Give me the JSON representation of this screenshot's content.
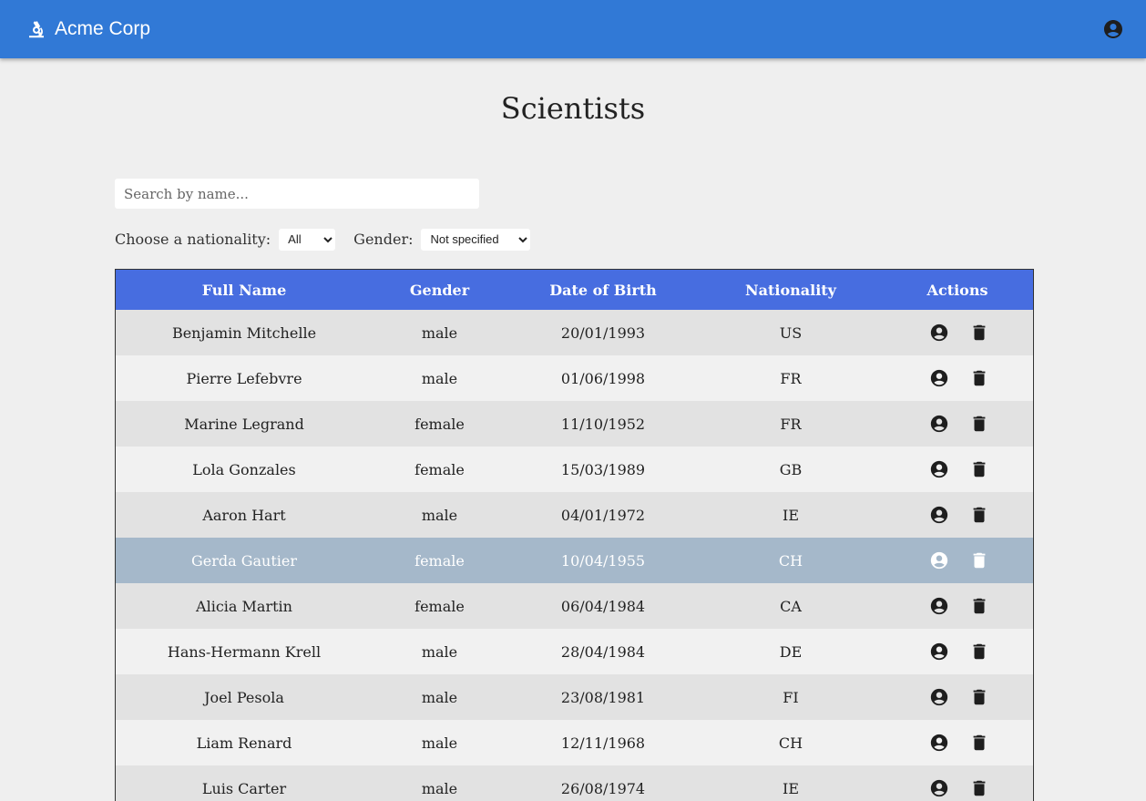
{
  "header": {
    "brand": "Acme Corp"
  },
  "page": {
    "title": "Scientists"
  },
  "search": {
    "placeholder": "Search by name...",
    "value": ""
  },
  "filters": {
    "nationality_label": "Choose a nationality:",
    "nationality_value": "All",
    "gender_label": "Gender:",
    "gender_value": "Not specified"
  },
  "table": {
    "columns": [
      "Full Name",
      "Gender",
      "Date of Birth",
      "Nationality",
      "Actions"
    ],
    "rows": [
      {
        "name": "Benjamin Mitchelle",
        "gender": "male",
        "dob": "20/01/1993",
        "nationality": "US"
      },
      {
        "name": "Pierre Lefebvre",
        "gender": "male",
        "dob": "01/06/1998",
        "nationality": "FR"
      },
      {
        "name": "Marine Legrand",
        "gender": "female",
        "dob": "11/10/1952",
        "nationality": "FR"
      },
      {
        "name": "Lola Gonzales",
        "gender": "female",
        "dob": "15/03/1989",
        "nationality": "GB"
      },
      {
        "name": "Aaron Hart",
        "gender": "male",
        "dob": "04/01/1972",
        "nationality": "IE"
      },
      {
        "name": "Gerda Gautier",
        "gender": "female",
        "dob": "10/04/1955",
        "nationality": "CH"
      },
      {
        "name": "Alicia Martin",
        "gender": "female",
        "dob": "06/04/1984",
        "nationality": "CA"
      },
      {
        "name": "Hans-Hermann Krell",
        "gender": "male",
        "dob": "28/04/1984",
        "nationality": "DE"
      },
      {
        "name": "Joel Pesola",
        "gender": "male",
        "dob": "23/08/1981",
        "nationality": "FI"
      },
      {
        "name": "Liam Renard",
        "gender": "male",
        "dob": "12/11/1968",
        "nationality": "CH"
      },
      {
        "name": "Luis Carter",
        "gender": "male",
        "dob": "26/08/1974",
        "nationality": "IE"
      }
    ],
    "selected_row": 5
  },
  "icons": {
    "brand": "microscope-icon",
    "account": "account-circle-icon",
    "row_view": "account-circle-icon",
    "row_delete": "trash-icon"
  },
  "colors": {
    "topbar": "#3179d6",
    "table_header": "#476de0",
    "selected_row": "#a5b8ca"
  }
}
